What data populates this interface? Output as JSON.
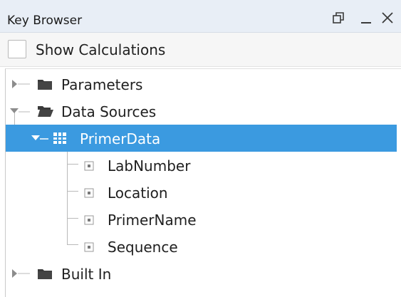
{
  "window": {
    "title": "Key Browser",
    "controls": [
      "restore-icon",
      "minimize-icon",
      "close-icon"
    ]
  },
  "options": {
    "show_calculations_label": "Show Calculations",
    "show_calculations_checked": false
  },
  "tree": {
    "selection_color": "#3b9ae0",
    "nodes": [
      {
        "label": "Parameters",
        "icon": "folder-icon",
        "expanded": false,
        "depth": 0
      },
      {
        "label": "Data Sources",
        "icon": "folder-open-icon",
        "expanded": true,
        "depth": 0
      },
      {
        "label": "PrimerData",
        "icon": "table-icon",
        "expanded": true,
        "depth": 1,
        "selected": true
      },
      {
        "label": "LabNumber",
        "icon": "field-icon",
        "depth": 2
      },
      {
        "label": "Location",
        "icon": "field-icon",
        "depth": 2
      },
      {
        "label": "PrimerName",
        "icon": "field-icon",
        "depth": 2
      },
      {
        "label": "Sequence",
        "icon": "field-icon",
        "depth": 2
      },
      {
        "label": "Built In",
        "icon": "folder-icon",
        "expanded": false,
        "depth": 0
      }
    ]
  }
}
